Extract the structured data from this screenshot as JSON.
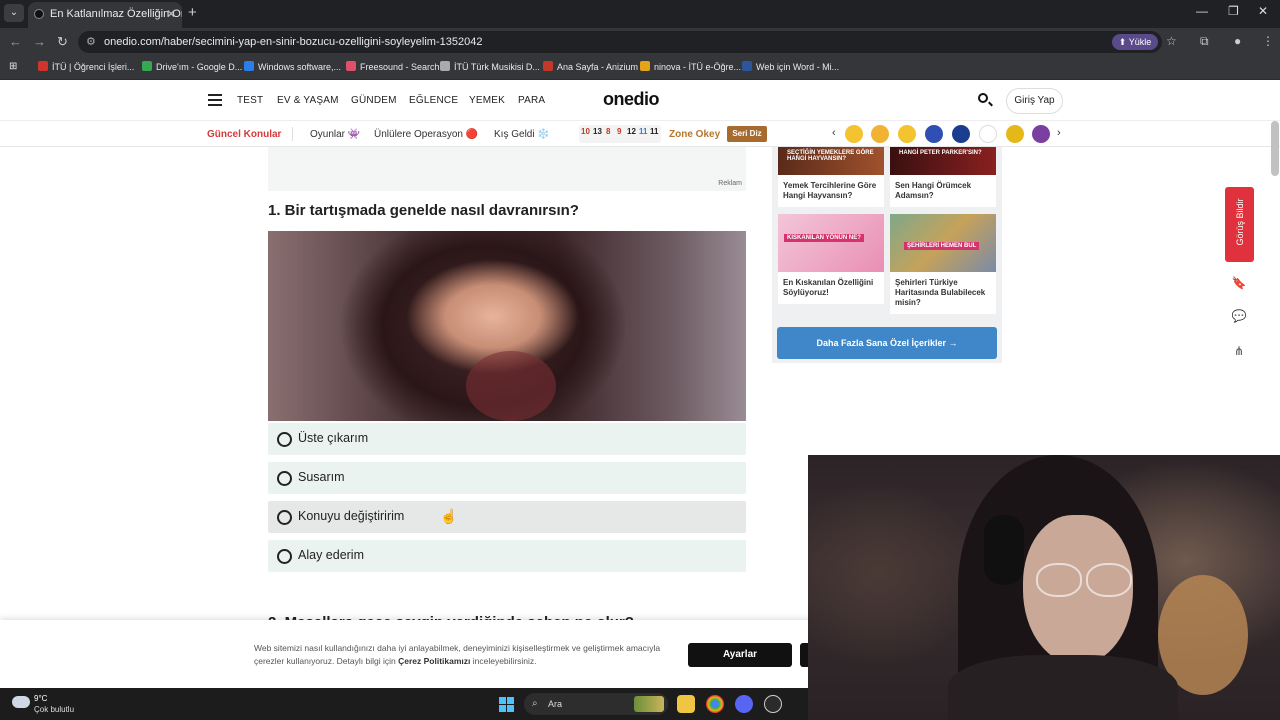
{
  "browser": {
    "tab_title": "En Katlanılmaz Özelliğin Ortaya",
    "url": "onedio.com/haber/secimini-yap-en-sinir-bozucu-ozelligini-soyleyelim-1352042",
    "upload_label": "Yükle",
    "bookmarks": [
      {
        "label": "İTÜ | Öğrenci İşleri...",
        "color": "#d0342c"
      },
      {
        "label": "Drive'ım - Google D...",
        "color": "#34a853"
      },
      {
        "label": "Windows software,...",
        "color": "#2b7de9"
      },
      {
        "label": "Freesound - Search",
        "color": "#e0506b"
      },
      {
        "label": "İTÜ Türk Musikisi D...",
        "color": "#aaaaaa"
      },
      {
        "label": "Ana Sayfa - Anizium",
        "color": "#c0392b"
      },
      {
        "label": "ninova - İTÜ e-Öğre...",
        "color": "#e5a31a"
      },
      {
        "label": "Web için Word - Mi...",
        "color": "#2b579a"
      }
    ]
  },
  "site": {
    "logo": "onedio",
    "nav": [
      "TEST",
      "EV & YAŞAM",
      "GÜNDEM",
      "EĞLENCE",
      "YEMEK",
      "PARA"
    ],
    "login": "Giriş Yap",
    "subnav": {
      "current": "Güncel Konular",
      "items": [
        "Oyunlar 👾",
        "Ünlülere Operasyon 🔴",
        "Kış Geldi ❄️"
      ],
      "numbers": [
        "10",
        "13",
        "8",
        "9",
        "12",
        "11",
        "11"
      ],
      "zone": "Zone Okey",
      "seri": "Seri Diz"
    }
  },
  "main": {
    "ad_label": "Reklam",
    "question1": "1. Bir tartışmada genelde nasıl davranırsın?",
    "answers": [
      "Üste çıkarım",
      "Susarım",
      "Konuyu değiştiririm",
      "Alay ederim"
    ],
    "question2": "2. Masallara gece sevgin verdiğinde seben ne olur?"
  },
  "sidebar": {
    "cards": [
      {
        "tag": "SEÇTİĞİN YEMEKLERE GÖRE HANGİ HAYVANSIN?",
        "title": "Yemek Tercihlerine Göre Hangi Hayvansın?"
      },
      {
        "tag": "HANGİ PETER PARKER'SIN?",
        "title": "Sen Hangi Örümcek Adamsın?"
      },
      {
        "tag": "KISKANILAN YÖNÜN NE?",
        "title": "En Kıskanılan Özelliğini Söylüyoruz!"
      },
      {
        "tag": "ŞEHİRLERİ HEMEN BUL",
        "title": "Şehirleri Türkiye Haritasında Bulabilecek misin?"
      }
    ],
    "more_button": "Daha Fazla Sana Özel İçerikler →"
  },
  "feedback": "Görüş Bildir",
  "cookie": {
    "text_pre": "Web sitemizi nasıl kullandığınızı daha iyi anlayabilmek, deneyiminizi kişiselleştirmek ve geliştirmek amacıyla çerezler kullanıyoruz. Detaylı bilgi için ",
    "link": "Çerez Politikamızı",
    "text_post": " inceleyebilirsiniz.",
    "settings": "Ayarlar"
  },
  "taskbar": {
    "temp": "9°C",
    "condition": "Çok bulutlu",
    "search": "Ara"
  }
}
